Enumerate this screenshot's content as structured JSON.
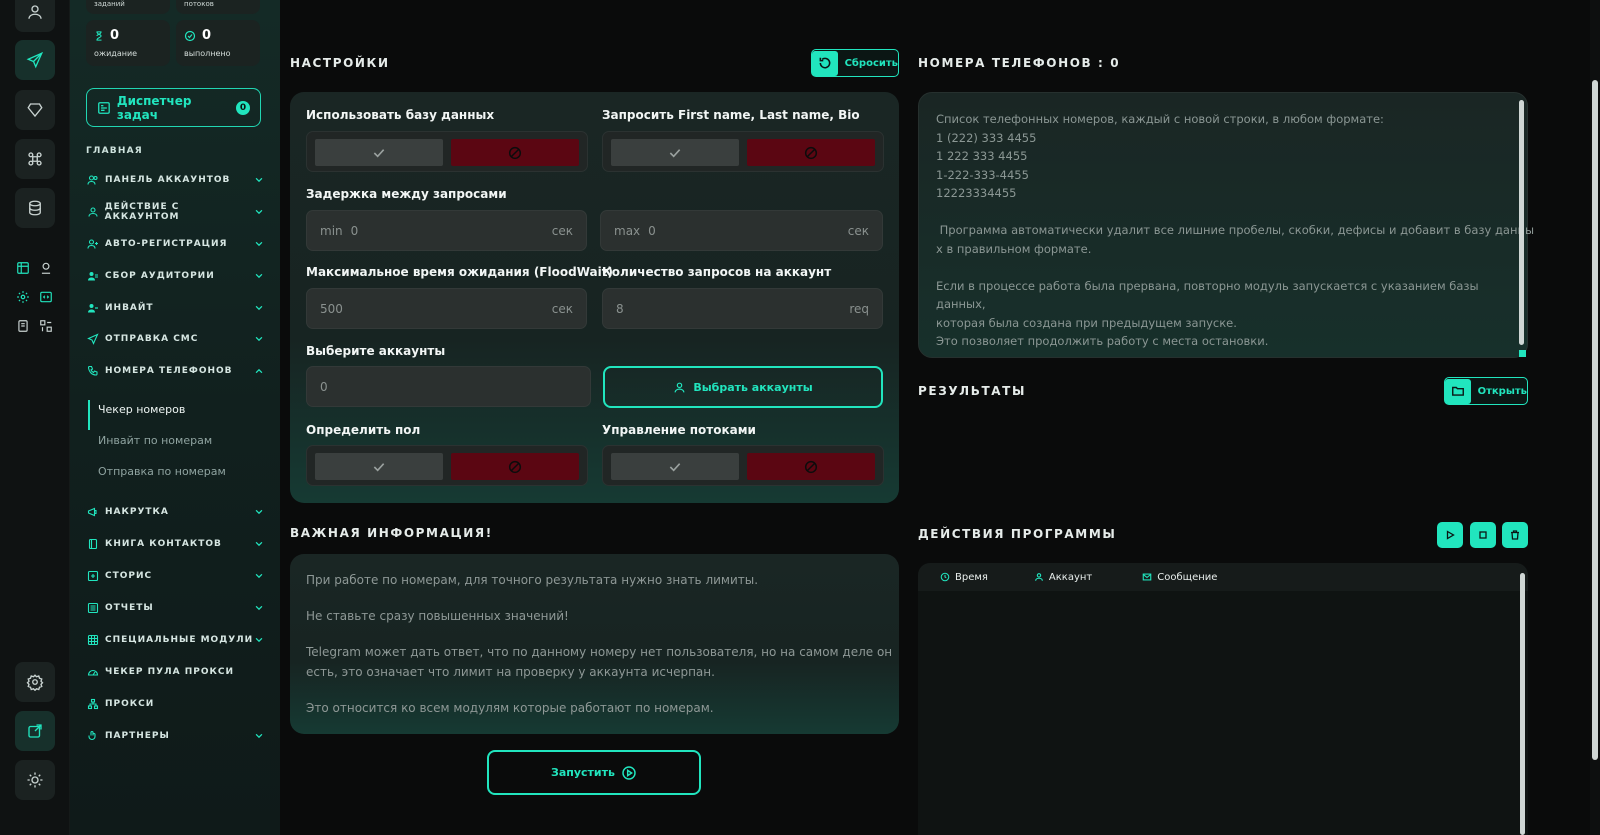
{
  "sidebar": {
    "stats_top": [
      "заданий",
      "потоков"
    ],
    "stats": [
      {
        "value": "0",
        "label": "ожидание"
      },
      {
        "value": "0",
        "label": "выполнено"
      }
    ],
    "dispatcher": {
      "label": "Диспетчер задач",
      "count": "0"
    },
    "section_title": "ГЛАВНАЯ",
    "items": [
      {
        "label": "ПАНЕЛЬ АККАУНТОВ"
      },
      {
        "label": "ДЕЙСТВИЕ С АККАУНТОМ"
      },
      {
        "label": "АВТО-РЕГИСТРАЦИЯ"
      },
      {
        "label": "СБОР АУДИТОРИИ"
      },
      {
        "label": "ИНВАЙТ"
      },
      {
        "label": "ОТПРАВКА СМС"
      },
      {
        "label": "НОМЕРА ТЕЛЕФОНОВ"
      },
      {
        "label": "НАКРУТКА"
      },
      {
        "label": "КНИГА КОНТАКТОВ"
      },
      {
        "label": "СТОРИС"
      },
      {
        "label": "ОТЧЕТЫ"
      },
      {
        "label": "СПЕЦИАЛЬНЫЕ МОДУЛИ"
      },
      {
        "label": "ЧЕКЕР ПУЛА ПРОКСИ"
      },
      {
        "label": "ПРОКСИ"
      },
      {
        "label": "ПАРТНЕРЫ"
      }
    ],
    "subitems": [
      "Чекер номеров",
      "Инвайт по номерам",
      "Отправка по номерам"
    ]
  },
  "settings": {
    "title": "НАСТРОЙКИ",
    "reset_label": "Сбросить",
    "use_db_label": "Использовать базу данных",
    "request_names_label": "Запросить First name, Last name, Bio",
    "delay_label": "Задержка между запросами",
    "delay_min": {
      "prefix": "min",
      "value": "0",
      "unit": "сек"
    },
    "delay_max": {
      "prefix": "max",
      "value": "0",
      "unit": "сек"
    },
    "floodwait_label": "Максимальное время ожидания (FloodWait)",
    "floodwait": {
      "value": "500",
      "unit": "сек"
    },
    "requests_label": "Количество запросов на аккаунт",
    "requests": {
      "value": "8",
      "unit": "req"
    },
    "accounts_label": "Выберите аккаунты",
    "accounts_value": "0",
    "select_accounts_button": "Выбрать аккаунты",
    "gender_label": "Определить пол",
    "threads_label": "Управление потоками"
  },
  "info": {
    "title": "ВАЖНАЯ ИНФОРМАЦИЯ!",
    "p1": "При работе по номерам, для точного результата нужно знать лимиты.",
    "p2": "Не ставьте сразу повышенных значений!",
    "p3a": "Telegram может дать ответ, что по данному номеру нет пользователя, но на самом деле он",
    "p3b": "есть, это означает что лимит на проверку у аккаунта исчерпан.",
    "p4": "Это относится ко всем модулям которые работают по номерам."
  },
  "start_button": "Запустить",
  "phones": {
    "title": "НОМЕРА ТЕЛЕФОНОВ : 0",
    "placeholder_lines": [
      "Список телефонных номеров, каждый с новой строки, в любом формате:",
      "1 (222) 333 4455",
      "1 222 333 4455",
      "1-222-333-4455",
      "12223334455",
      "",
      " Программа автоматически удалит все лишние пробелы, скобки, дефисы и добавит в базу данны",
      "х в правильном формате.",
      "",
      "Если в процессе работа была прервана, повторно модуль запускается с указанием базы данных,",
      "которая была создана при предыдущем запуске.",
      "Это позволяет продолжить работу с места остановки."
    ]
  },
  "results": {
    "title": "РЕЗУЛЬТАТЫ",
    "open_label": "Открыть"
  },
  "actions": {
    "title": "ДЕЙСТВИЯ ПРОГРАММЫ",
    "columns": [
      "Время",
      "Аккаунт",
      "Сообщение"
    ]
  },
  "colors": {
    "accent": "#21e5be",
    "danger": "#5b0612",
    "bg": "#0a0b0b"
  }
}
